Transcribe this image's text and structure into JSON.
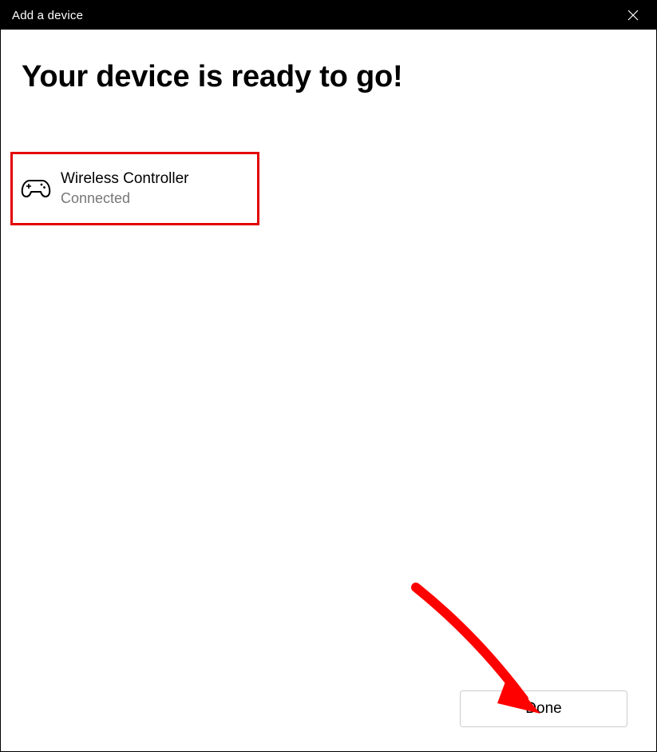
{
  "window": {
    "title": "Add a device"
  },
  "heading": "Your device is ready to go!",
  "device": {
    "name": "Wireless Controller",
    "status": "Connected",
    "icon": "controller-icon"
  },
  "actions": {
    "done_label": "Done"
  },
  "annotations": {
    "highlight_color": "#e30000",
    "arrow_color": "#ff0000"
  }
}
